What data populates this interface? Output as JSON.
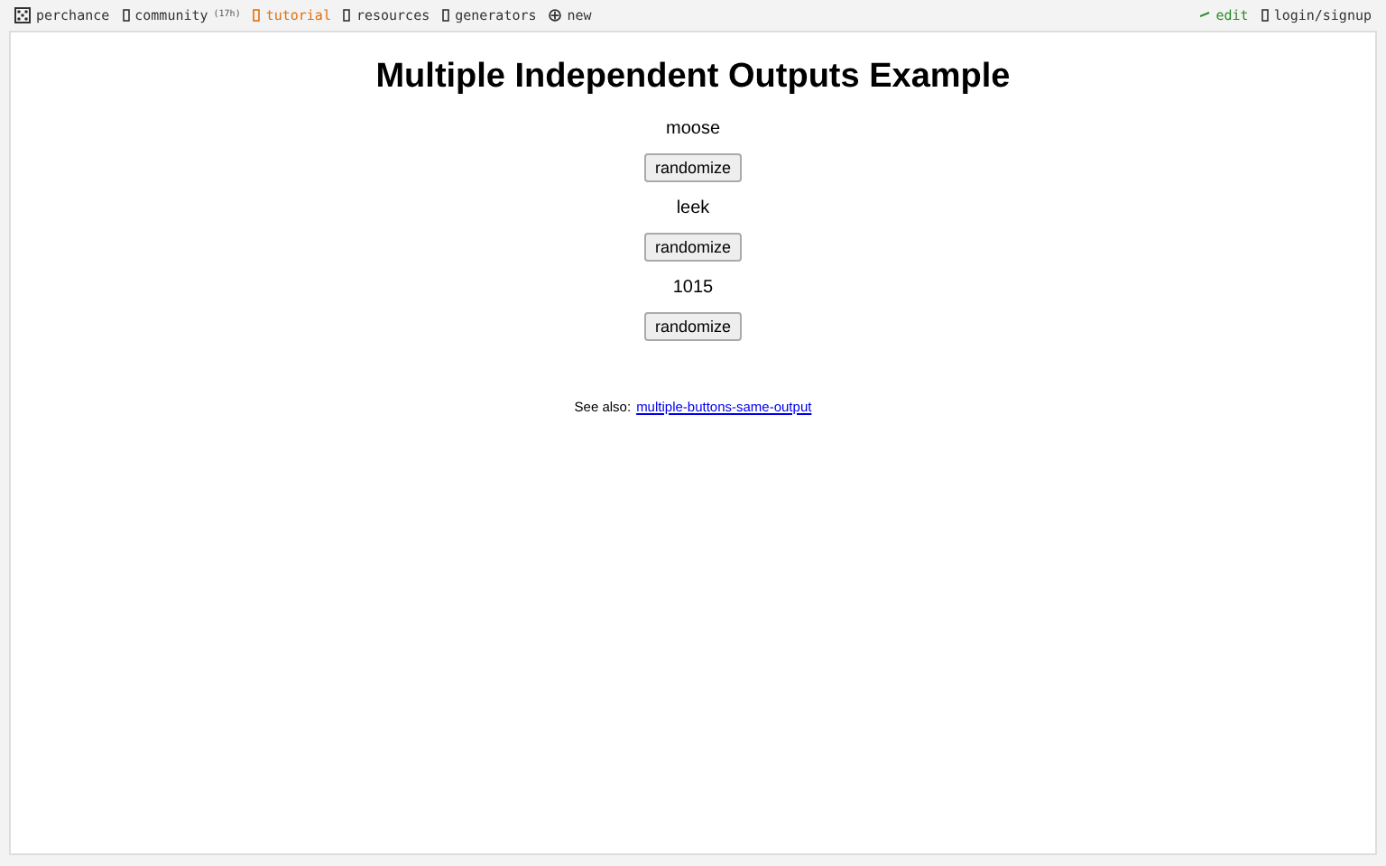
{
  "nav": {
    "logo": "perchance",
    "items": [
      {
        "label": "community",
        "badge": "(17h)",
        "selected": false,
        "kind": "page"
      },
      {
        "label": "tutorial",
        "selected": true,
        "kind": "page"
      },
      {
        "label": "resources",
        "selected": false,
        "kind": "page"
      },
      {
        "label": "generators",
        "selected": false,
        "kind": "page"
      },
      {
        "label": "new",
        "selected": false,
        "kind": "new"
      }
    ],
    "right": [
      {
        "label": "edit",
        "kind": "edit"
      },
      {
        "label": "login/signup",
        "kind": "plain"
      }
    ]
  },
  "page": {
    "title": "Multiple Independent Outputs Example",
    "outputs": [
      {
        "value": "moose",
        "button": "randomize"
      },
      {
        "value": "leek",
        "button": "randomize"
      },
      {
        "value": "1015",
        "button": "randomize"
      }
    ],
    "see_also": {
      "label": "See also:",
      "link": "multiple-buttons-same-output"
    }
  }
}
